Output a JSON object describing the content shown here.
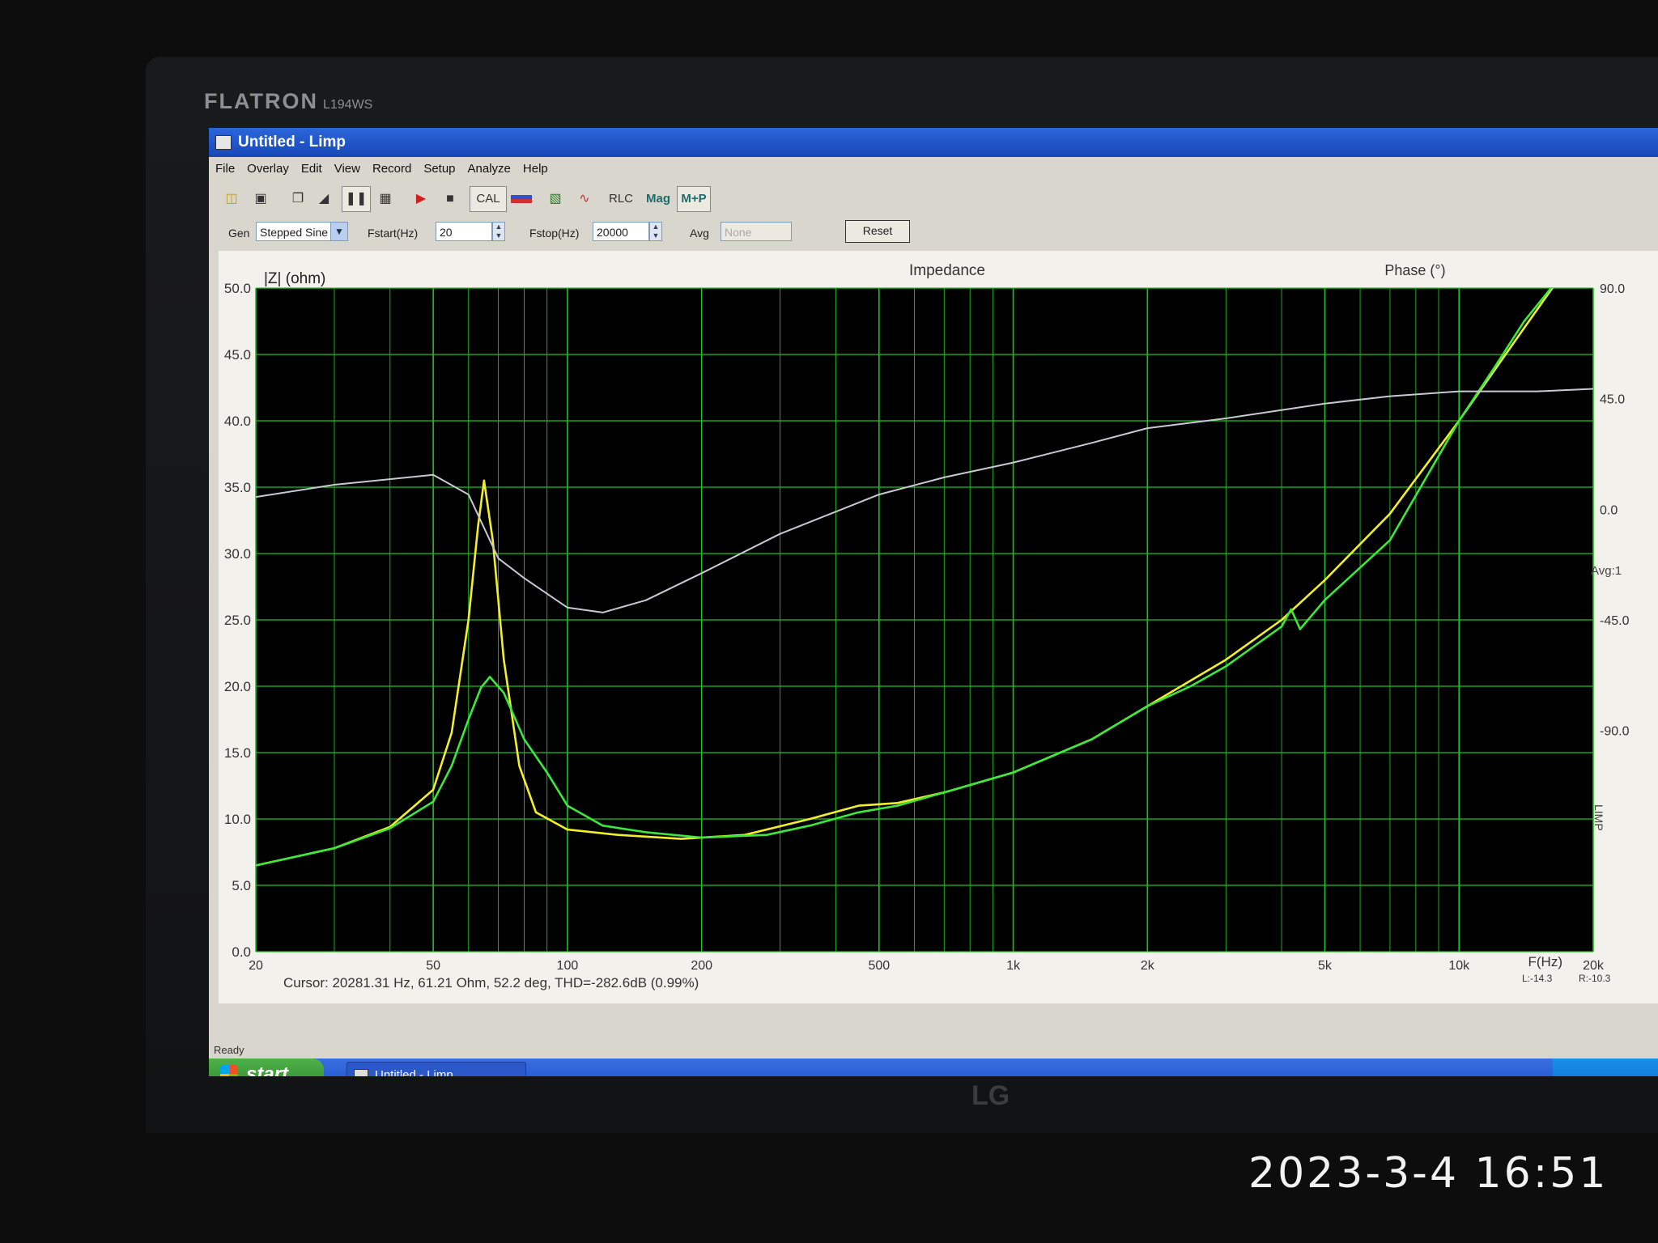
{
  "monitor": {
    "brand": "FLATRON",
    "model": "L194WS",
    "logo": "LG"
  },
  "window": {
    "title": "Untitled - Limp"
  },
  "menu": [
    "File",
    "Overlay",
    "Edit",
    "View",
    "Record",
    "Setup",
    "Analyze",
    "Help"
  ],
  "toolbar": {
    "cal": "CAL",
    "rlc": "RLC",
    "mag": "Mag",
    "mp": "M+P"
  },
  "controls": {
    "gen_label": "Gen",
    "gen_value": "Stepped Sine",
    "fstart_label": "Fstart(Hz)",
    "fstart_value": "20",
    "fstop_label": "Fstop(Hz)",
    "fstop_value": "20000",
    "avg_label": "Avg",
    "avg_value": "None",
    "reset": "Reset"
  },
  "side_text": {
    "avg": "Avg:1",
    "limp": "LIMP",
    "l_value": "L:-14.3",
    "r_value": "R:-10.3"
  },
  "cursor": "Cursor: 20281.31 Hz, 61.21 Ohm, 52.2 deg, THD=-282.6dB (0.99%)",
  "status": "Ready",
  "taskbar": {
    "start": "start",
    "task": "Untitled - Limp"
  },
  "timestamp": "2023-3-4 16:51",
  "colors": {
    "plot_bg": "#000000",
    "grid": "#1fc21f",
    "yellow": "#f2ee2c",
    "green": "#3de83d",
    "phase": "#c9c9d4",
    "titlebar": "#2458c9"
  },
  "chart_data": {
    "type": "line",
    "title": "Impedance",
    "xlabel": "F(Hz)",
    "ylabel": "|Z| (ohm)",
    "y2label": "Phase (°)",
    "x_scale": "log",
    "xlim": [
      20,
      20000
    ],
    "ylim": [
      0,
      50
    ],
    "y2lim": [
      -180,
      90
    ],
    "grid": true,
    "x_ticks": [
      20,
      50,
      100,
      200,
      500,
      1000,
      2000,
      5000,
      10000,
      20000
    ],
    "x_tick_labels": [
      "20",
      "50",
      "100",
      "200",
      "500",
      "1k",
      "2k",
      "5k",
      "10k",
      "20k"
    ],
    "y_ticks": [
      0,
      5,
      10,
      15,
      20,
      25,
      30,
      35,
      40,
      45,
      50
    ],
    "y_tick_labels": [
      "0.0",
      "5.0",
      "10.0",
      "15.0",
      "20.0",
      "25.0",
      "30.0",
      "35.0",
      "40.0",
      "45.0",
      "50.0"
    ],
    "y2_ticks": [
      90,
      45,
      0,
      -45,
      -90
    ],
    "y2_tick_labels": [
      "90.0",
      "45.0",
      "0.0",
      "-45.0",
      "-90.0"
    ],
    "series": [
      {
        "color": "#f2ee2c",
        "axis": "left",
        "points": [
          [
            20,
            6.5
          ],
          [
            30,
            7.8
          ],
          [
            40,
            9.4
          ],
          [
            50,
            12.2
          ],
          [
            55,
            16.5
          ],
          [
            60,
            25
          ],
          [
            63,
            32
          ],
          [
            65,
            35.5
          ],
          [
            68,
            31
          ],
          [
            72,
            22
          ],
          [
            78,
            14
          ],
          [
            85,
            10.5
          ],
          [
            100,
            9.2
          ],
          [
            130,
            8.8
          ],
          [
            180,
            8.5
          ],
          [
            250,
            8.8
          ],
          [
            350,
            10
          ],
          [
            450,
            11
          ],
          [
            550,
            11.2
          ],
          [
            700,
            12
          ],
          [
            1000,
            13.5
          ],
          [
            1500,
            16
          ],
          [
            2000,
            18.5
          ],
          [
            3000,
            22
          ],
          [
            4000,
            25
          ],
          [
            5000,
            28
          ],
          [
            7000,
            33
          ],
          [
            10000,
            40
          ],
          [
            14000,
            47
          ],
          [
            17000,
            51
          ]
        ]
      },
      {
        "color": "#3de83d",
        "axis": "left",
        "points": [
          [
            20,
            6.5
          ],
          [
            30,
            7.8
          ],
          [
            40,
            9.3
          ],
          [
            50,
            11.3
          ],
          [
            55,
            14
          ],
          [
            60,
            17.5
          ],
          [
            64,
            19.9
          ],
          [
            67,
            20.7
          ],
          [
            72,
            19.5
          ],
          [
            80,
            16
          ],
          [
            90,
            13.5
          ],
          [
            100,
            11
          ],
          [
            120,
            9.5
          ],
          [
            150,
            9
          ],
          [
            200,
            8.6
          ],
          [
            280,
            8.8
          ],
          [
            350,
            9.5
          ],
          [
            450,
            10.5
          ],
          [
            550,
            11
          ],
          [
            700,
            12
          ],
          [
            1000,
            13.5
          ],
          [
            1500,
            16
          ],
          [
            2000,
            18.5
          ],
          [
            2500,
            20
          ],
          [
            3000,
            21.5
          ],
          [
            4000,
            24.5
          ],
          [
            4200,
            25.8
          ],
          [
            4400,
            24.3
          ],
          [
            5000,
            26.5
          ],
          [
            7000,
            31
          ],
          [
            10000,
            40
          ],
          [
            12000,
            44
          ],
          [
            14000,
            47.5
          ],
          [
            17000,
            51
          ]
        ]
      },
      {
        "color": "#c9c9d4",
        "axis": "right",
        "points": [
          [
            20,
            5
          ],
          [
            30,
            10
          ],
          [
            50,
            14
          ],
          [
            60,
            6
          ],
          [
            70,
            -20
          ],
          [
            80,
            -28
          ],
          [
            100,
            -40
          ],
          [
            120,
            -42
          ],
          [
            150,
            -37
          ],
          [
            200,
            -26
          ],
          [
            300,
            -10
          ],
          [
            500,
            6
          ],
          [
            700,
            13
          ],
          [
            1000,
            19
          ],
          [
            1500,
            27
          ],
          [
            2000,
            33
          ],
          [
            3000,
            37
          ],
          [
            5000,
            43
          ],
          [
            7000,
            46
          ],
          [
            10000,
            48
          ],
          [
            15000,
            48
          ],
          [
            20000,
            49
          ]
        ]
      }
    ]
  }
}
